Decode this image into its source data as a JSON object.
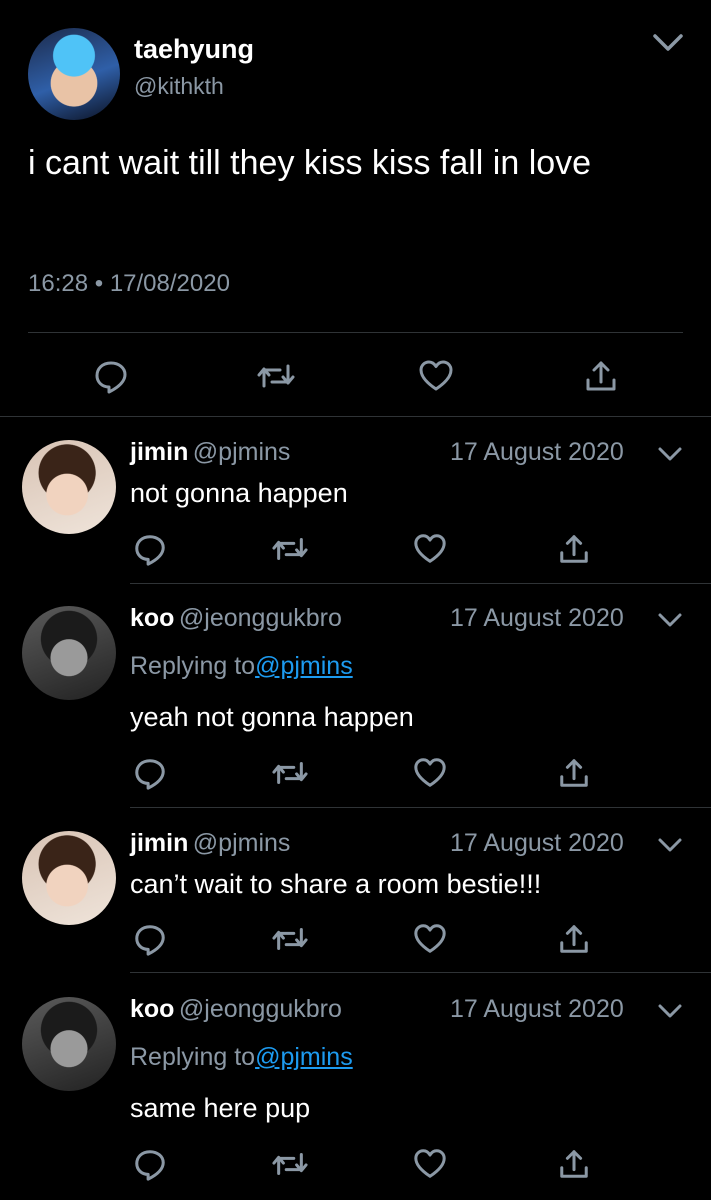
{
  "main_tweet": {
    "display_name": "taehyung",
    "handle": "@kithkth",
    "text": "i cant wait till they kiss kiss fall in love",
    "time": "16:28",
    "dot": "•",
    "date": "17/08/2020"
  },
  "replies": [
    {
      "display_name": "jimin",
      "handle": "@pjmins",
      "date": "17 August 2020",
      "replying_label": "",
      "replying_to": "",
      "text": "not gonna happen"
    },
    {
      "display_name": "koo",
      "handle": "@jeonggukbro",
      "date": "17 August 2020",
      "replying_label": "Replying to",
      "replying_to": "@pjmins",
      "text": "yeah not gonna happen"
    },
    {
      "display_name": "jimin",
      "handle": "@pjmins",
      "date": "17 August 2020",
      "replying_label": "",
      "replying_to": "",
      "text": "can’t wait to share a room bestie!!!"
    },
    {
      "display_name": "koo",
      "handle": "@jeonggukbro",
      "date": "17 August 2020",
      "replying_label": "Replying to",
      "replying_to": "@pjmins",
      "text": "same here pup"
    }
  ],
  "icons": {
    "reply": "reply-icon",
    "retweet": "retweet-icon",
    "like": "heart-icon",
    "share": "share-icon",
    "menu": "chevron-down-icon"
  },
  "colors": {
    "background": "#000000",
    "secondary_text": "#8b98a5",
    "link": "#1d9bf0",
    "divider": "#2f3336"
  }
}
